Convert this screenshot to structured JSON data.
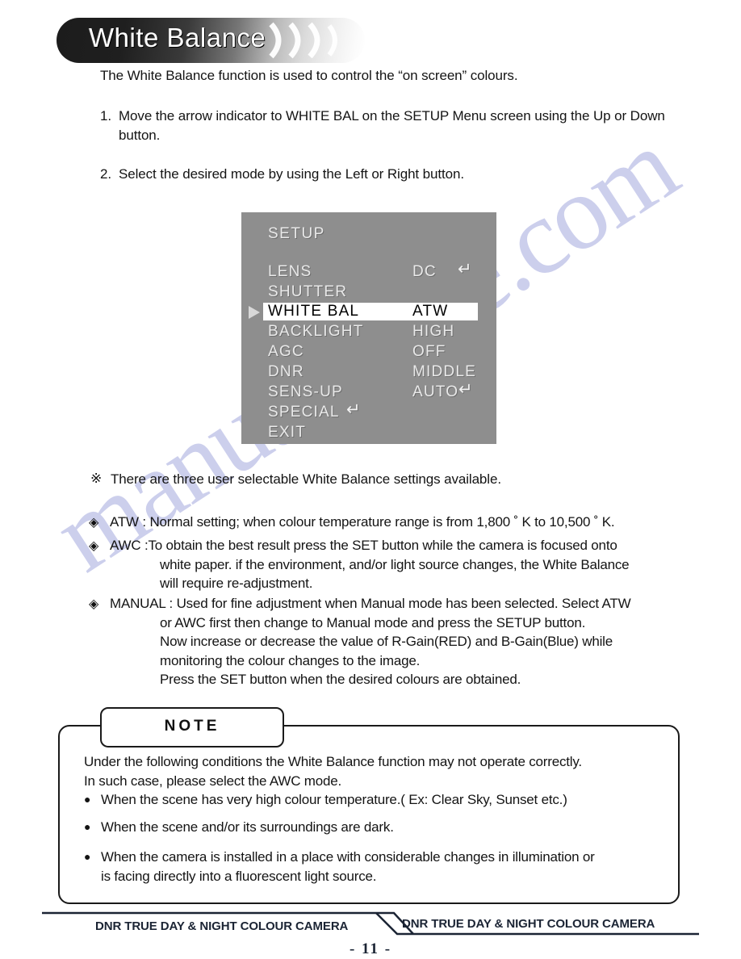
{
  "header": {
    "title": "White Balance",
    "decoration_icon": "wave-arcs-icon"
  },
  "intro": "The White Balance function is used to control the “on screen” colours.",
  "steps": [
    {
      "number": "1.",
      "text": "Move the arrow indicator to WHITE BAL on the SETUP Menu screen using the Up or Down button."
    },
    {
      "number": "2.",
      "text": "Select the desired mode by using the Left or Right button."
    }
  ],
  "osd": {
    "title": "SETUP",
    "cursor_icon": "right-triangle-cursor",
    "enter_glyph": "↵",
    "rows": [
      {
        "label": "LENS",
        "value": "DC",
        "enter": true,
        "selected": false
      },
      {
        "label": "SHUTTER",
        "value": "",
        "enter": false,
        "selected": false
      },
      {
        "label": "WHITE BAL",
        "value": "ATW",
        "enter": false,
        "selected": true
      },
      {
        "label": "BACKLIGHT",
        "value": "HIGH",
        "enter": false,
        "selected": false
      },
      {
        "label": "AGC",
        "value": "OFF",
        "enter": false,
        "selected": false
      },
      {
        "label": "DNR",
        "value": "MIDDLE",
        "enter": false,
        "selected": false
      },
      {
        "label": "SENS-UP",
        "value": "AUTO",
        "enter": true,
        "selected": false
      },
      {
        "label": "SPECIAL",
        "value": "",
        "enter": true,
        "selected": false
      },
      {
        "label": "EXIT",
        "value": "",
        "enter": false,
        "selected": false
      }
    ]
  },
  "star_note": {
    "marker": "※",
    "text": "There are three user selectable White Balance settings available."
  },
  "modes": [
    {
      "marker": "◈",
      "text": "ATW : Normal setting; when colour temperature range is from 1,800 ˚ K to 10,500 ˚ K.",
      "continuation": []
    },
    {
      "marker": "◈",
      "text": "AWC :To obtain the best result press the SET button while the camera is focused onto",
      "continuation": [
        "white paper. if the environment, and/or light source changes, the White Balance",
        "will require re-adjustment."
      ]
    },
    {
      "marker": "◈",
      "text": "MANUAL :  Used for fine adjustment when Manual mode has been selected. Select ATW",
      "continuation": [
        "or AWC first then change to Manual mode and press the SETUP button.",
        "Now increase or decrease the value of R-Gain(RED) and B-Gain(Blue) while",
        "monitoring the colour changes to the image.",
        "Press the SET button when the desired colours are obtained."
      ]
    }
  ],
  "note": {
    "tab_label": "NOTE",
    "intro_line_1": "Under the following conditions the White Balance function may not operate correctly.",
    "intro_line_2": "In such case, please select the AWC mode.",
    "bullets": [
      {
        "marker": "●",
        "lines": [
          "When the scene has very high colour temperature.( Ex: Clear Sky, Sunset etc.)"
        ]
      },
      {
        "marker": "●",
        "lines": [
          "When the scene and/or its surroundings are dark."
        ]
      },
      {
        "marker": "●",
        "lines": [
          "When the camera is installed in a place with considerable changes in illumination or",
          "is facing directly into a fluorescent light source."
        ]
      }
    ]
  },
  "footer": {
    "left_label": "DNR TRUE DAY & NIGHT COLOUR CAMERA",
    "right_label": "DNR TRUE DAY & NIGHT COLOUR CAMERA",
    "page_number": "- 11 -"
  },
  "watermark": {
    "text": "manualshive.com"
  },
  "colors": {
    "osd_background": "#8e8e8e",
    "osd_text": "#e9e9e9",
    "osd_selected_background": "#ffffff",
    "osd_selected_text": "#000000",
    "footer_text": "#1b2434",
    "watermark": "#b9bde6"
  }
}
